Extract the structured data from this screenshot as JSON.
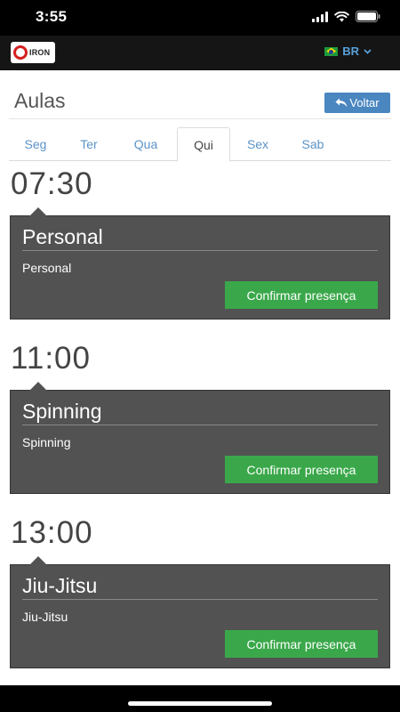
{
  "status_bar": {
    "time": "3:55"
  },
  "app_bar": {
    "logo_text": "IRON",
    "language": {
      "code": "BR",
      "icon": "flag-brazil-icon"
    }
  },
  "page": {
    "title": "Aulas",
    "back_label": "Voltar"
  },
  "tabs": [
    {
      "label": "Seg",
      "active": false
    },
    {
      "label": "Ter",
      "active": false
    },
    {
      "label": "Qua",
      "active": false
    },
    {
      "label": "Qui",
      "active": true
    },
    {
      "label": "Sex",
      "active": false
    },
    {
      "label": "Sab",
      "active": false
    }
  ],
  "classes": [
    {
      "time": "07:30",
      "title": "Personal",
      "subtitle": "Personal",
      "button_label": "Confirmar presença"
    },
    {
      "time": "11:00",
      "title": "Spinning",
      "subtitle": "Spinning",
      "button_label": "Confirmar presença"
    },
    {
      "time": "13:00",
      "title": "Jiu-Jitsu",
      "subtitle": "Jiu-Jitsu",
      "button_label": "Confirmar presença"
    }
  ],
  "colors": {
    "app_bar_bg": "#151515",
    "accent_blue": "#4a86c0",
    "confirm_green": "#3aa84a",
    "card_bg": "#525252"
  }
}
